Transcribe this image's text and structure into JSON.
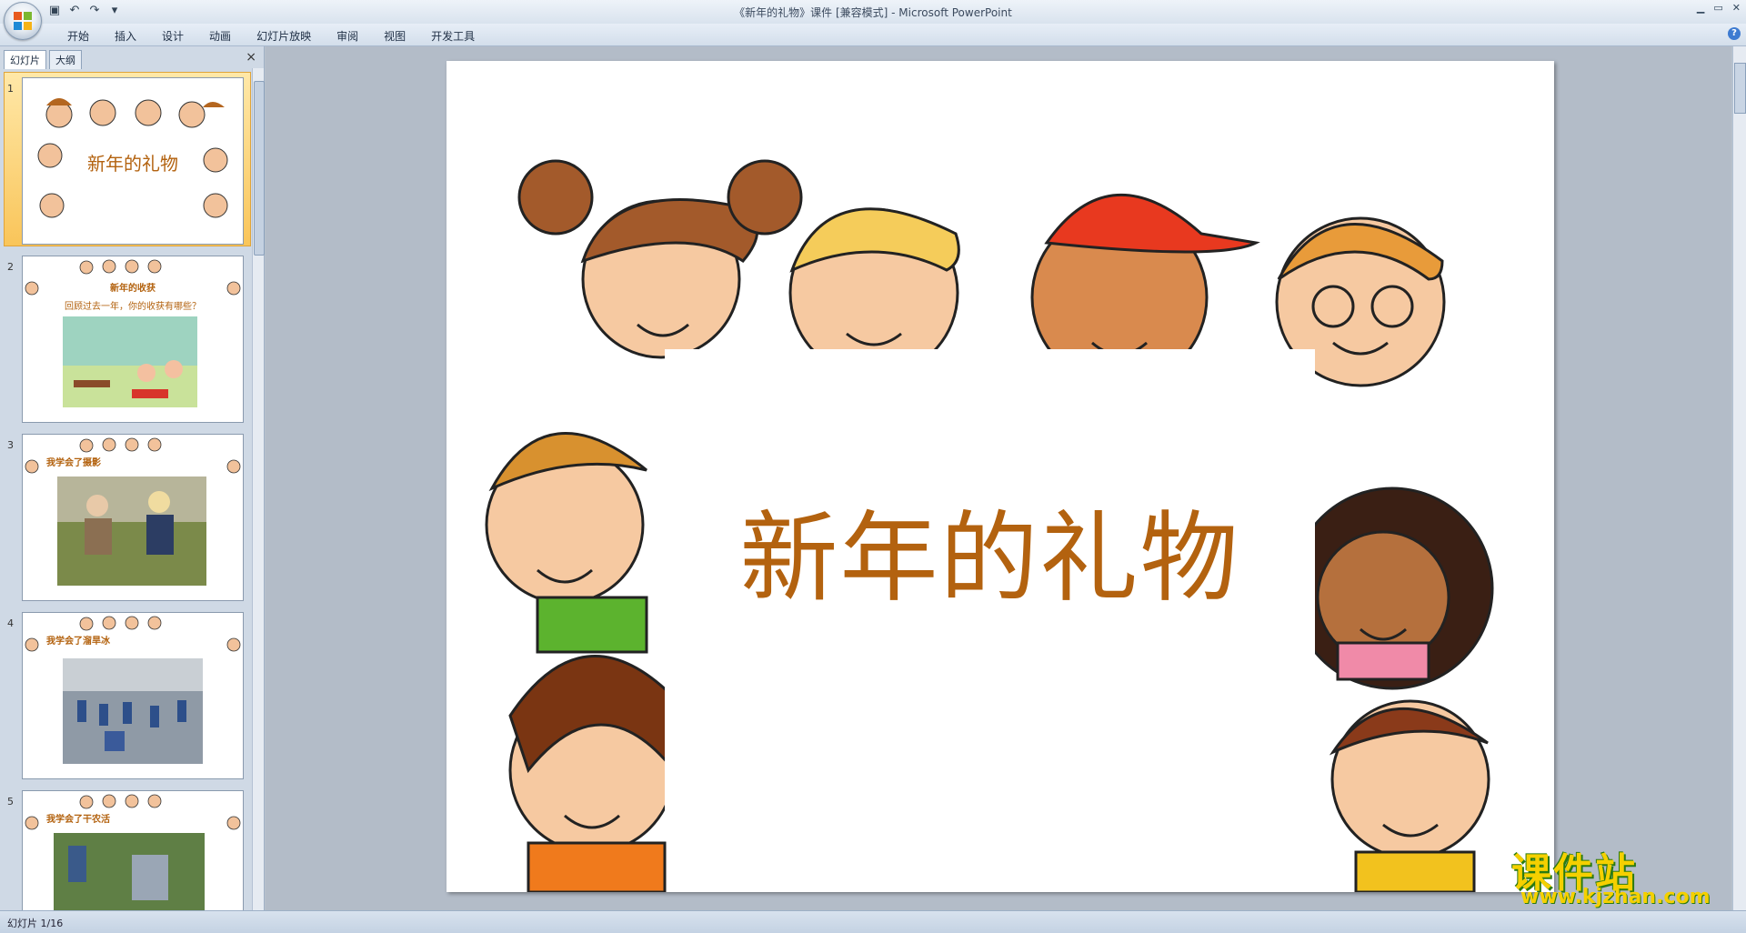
{
  "window": {
    "title": "《新年的礼物》课件 [兼容模式] - Microsoft PowerPoint"
  },
  "ribbon": {
    "tabs": [
      "开始",
      "插入",
      "设计",
      "动画",
      "幻灯片放映",
      "审阅",
      "视图",
      "开发工具"
    ]
  },
  "left_pane": {
    "tab_slides": "幻灯片",
    "tab_outline": "大纲",
    "close": "×",
    "thumbnails": [
      {
        "num": "1",
        "title": "新年的礼物",
        "subtitle": ""
      },
      {
        "num": "2",
        "title": "新年的收获",
        "subtitle": "回顾过去一年，你的收获有哪些？"
      },
      {
        "num": "3",
        "title": "我学会了摄影",
        "subtitle": ""
      },
      {
        "num": "4",
        "title": "我学会了溜旱冰",
        "subtitle": ""
      },
      {
        "num": "5",
        "title": "我学会了干农活",
        "subtitle": ""
      }
    ]
  },
  "slide": {
    "title": "新年的礼物"
  },
  "status": {
    "slide_indicator": "幻灯片 1/16"
  },
  "watermark": {
    "cn": "课件站",
    "en": "www.kjzhan.com"
  },
  "colors": {
    "title_orange": "#b3620f",
    "selection": "#f5a623"
  }
}
